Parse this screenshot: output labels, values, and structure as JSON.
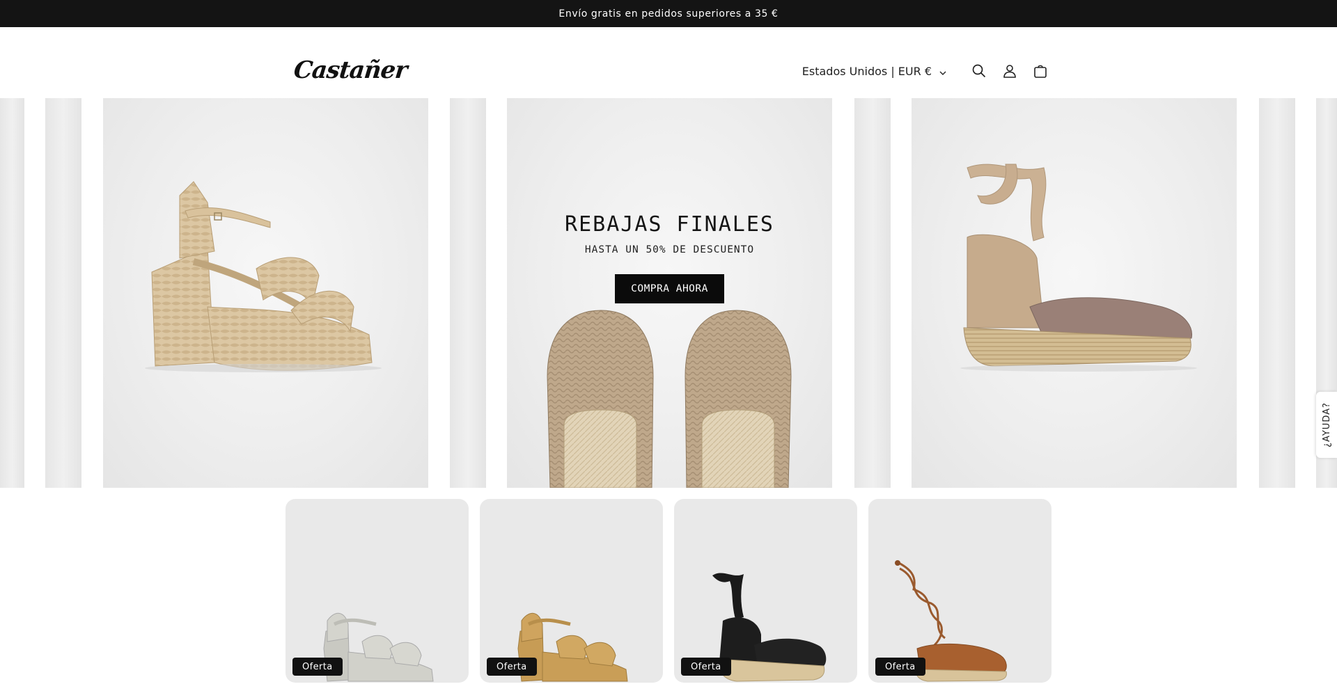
{
  "announcement": {
    "text": "Envío gratis en pedidos superiores a 35 €"
  },
  "header": {
    "logo": "Castañer",
    "country_selector": "Estados Unidos | EUR €",
    "icons": [
      "search-icon",
      "account-icon",
      "cart-icon"
    ]
  },
  "hero": {
    "promo": {
      "title": "REBAJAS FINALES",
      "subtitle": "HASTA UN 50% DE DESCUENTO",
      "cta": "COMPRA AHORA"
    }
  },
  "help_tab": {
    "label": "¿AYUDA?"
  },
  "products": [
    {
      "badge": "Oferta"
    },
    {
      "badge": "Oferta"
    },
    {
      "badge": "Oferta"
    },
    {
      "badge": "Oferta"
    }
  ],
  "colors": {
    "announcement_bg": "#141414",
    "panel_bg": "#eeeeee",
    "cta_bg": "#0b0b0b",
    "card_bg": "#e9e9e9",
    "badge_bg": "#111111"
  }
}
